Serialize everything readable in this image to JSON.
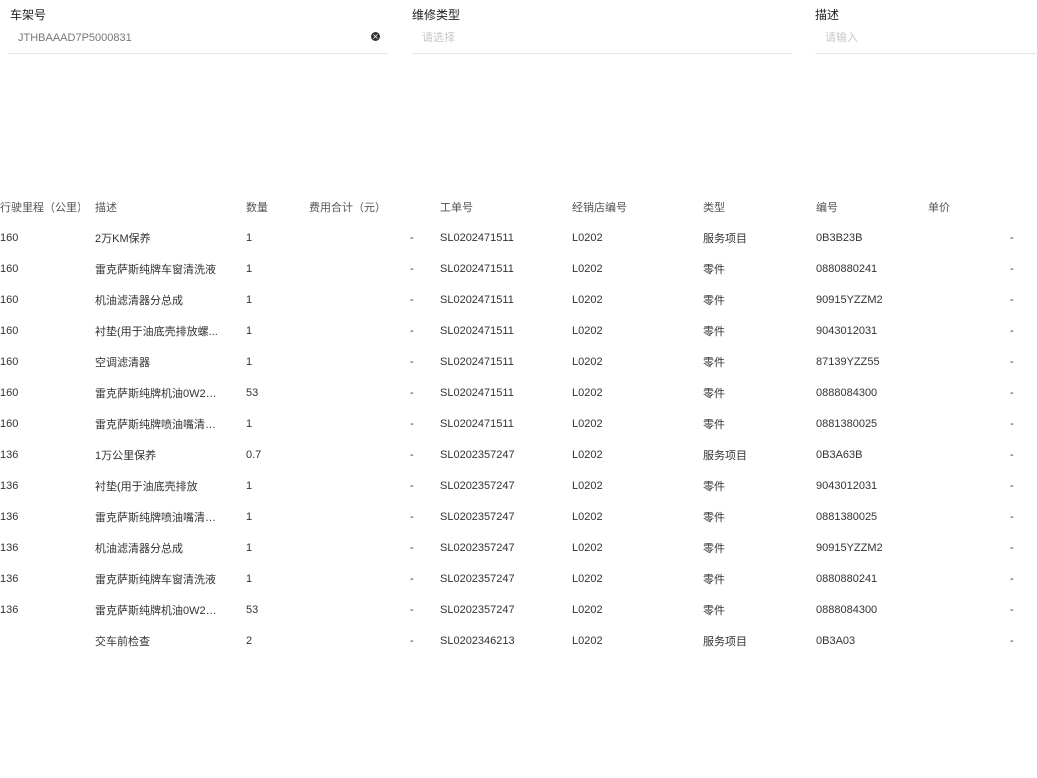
{
  "filters": {
    "vin": {
      "label": "车架号",
      "value": "JTHBAAAD7P5000831"
    },
    "repair_type": {
      "label": "维修类型",
      "placeholder": "请选择"
    },
    "description": {
      "label": "描述",
      "placeholder": "请输入"
    }
  },
  "table": {
    "headers": [
      "行驶里程（公里）",
      "描述",
      "数量",
      "费用合计（元）",
      "工单号",
      "经销店编号",
      "类型",
      "编号",
      "单价"
    ],
    "rows": [
      {
        "mileage": "160",
        "desc": "2万KM保养",
        "qty": "1",
        "total": "-",
        "order": "SL0202471511",
        "dealer": "L0202",
        "type": "服务项目",
        "code": "0B3B23B",
        "price": "-"
      },
      {
        "mileage": "160",
        "desc": "雷克萨斯纯牌车窗清洗液",
        "qty": "1",
        "total": "-",
        "order": "SL0202471511",
        "dealer": "L0202",
        "type": "零件",
        "code": "0880880241",
        "price": "-"
      },
      {
        "mileage": "160",
        "desc": "机油滤清器分总成",
        "qty": "1",
        "total": "-",
        "order": "SL0202471511",
        "dealer": "L0202",
        "type": "零件",
        "code": "90915YZZM2",
        "price": "-"
      },
      {
        "mileage": "160",
        "desc": "衬垫(用于油底壳排放螺...",
        "qty": "1",
        "total": "-",
        "order": "SL0202471511",
        "dealer": "L0202",
        "type": "零件",
        "code": "9043012031",
        "price": "-"
      },
      {
        "mileage": "160",
        "desc": "空调滤清器",
        "qty": "1",
        "total": "-",
        "order": "SL0202471511",
        "dealer": "L0202",
        "type": "零件",
        "code": "87139YZZ55",
        "price": "-"
      },
      {
        "mileage": "160",
        "desc": "雷克萨斯纯牌机油0W20...",
        "qty": "53",
        "total": "-",
        "order": "SL0202471511",
        "dealer": "L0202",
        "type": "零件",
        "code": "0888084300",
        "price": "-"
      },
      {
        "mileage": "160",
        "desc": "雷克萨斯纯牌喷油嘴清洗剂",
        "qty": "1",
        "total": "-",
        "order": "SL0202471511",
        "dealer": "L0202",
        "type": "零件",
        "code": "0881380025",
        "price": "-"
      },
      {
        "mileage": "136",
        "desc": "1万公里保养",
        "qty": "0.7",
        "total": "-",
        "order": "SL0202357247",
        "dealer": "L0202",
        "type": "服务项目",
        "code": "0B3A63B",
        "price": "-"
      },
      {
        "mileage": "136",
        "desc": "衬垫(用于油底壳排放",
        "qty": "1",
        "total": "-",
        "order": "SL0202357247",
        "dealer": "L0202",
        "type": "零件",
        "code": "9043012031",
        "price": "-"
      },
      {
        "mileage": "136",
        "desc": "雷克萨斯纯牌喷油嘴清洗剂",
        "qty": "1",
        "total": "-",
        "order": "SL0202357247",
        "dealer": "L0202",
        "type": "零件",
        "code": "0881380025",
        "price": "-"
      },
      {
        "mileage": "136",
        "desc": "机油滤清器分总成",
        "qty": "1",
        "total": "-",
        "order": "SL0202357247",
        "dealer": "L0202",
        "type": "零件",
        "code": "90915YZZM2",
        "price": "-"
      },
      {
        "mileage": "136",
        "desc": "雷克萨斯纯牌车窗清洗液",
        "qty": "1",
        "total": "-",
        "order": "SL0202357247",
        "dealer": "L0202",
        "type": "零件",
        "code": "0880880241",
        "price": "-"
      },
      {
        "mileage": "136",
        "desc": "雷克萨斯纯牌机油0W20...",
        "qty": "53",
        "total": "-",
        "order": "SL0202357247",
        "dealer": "L0202",
        "type": "零件",
        "code": "0888084300",
        "price": "-"
      },
      {
        "mileage": "",
        "desc": "交车前检查",
        "qty": "2",
        "total": "-",
        "order": "SL0202346213",
        "dealer": "L0202",
        "type": "服务项目",
        "code": "0B3A03",
        "price": "-"
      }
    ]
  }
}
